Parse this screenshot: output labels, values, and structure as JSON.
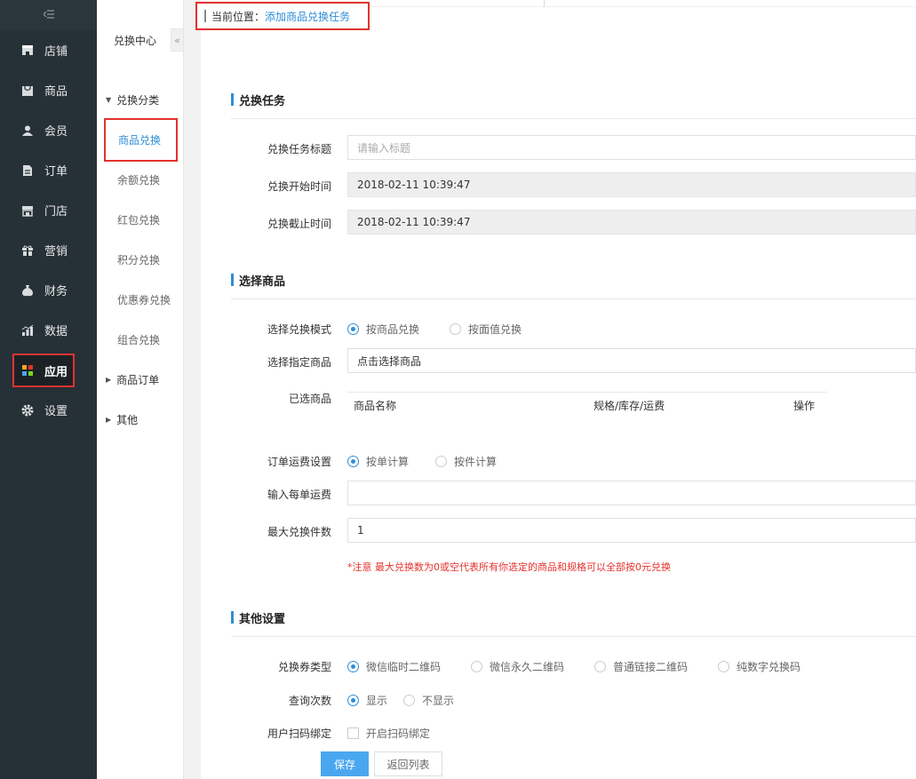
{
  "sidebar": {
    "collapse_icon": "collapse-icon",
    "items": [
      {
        "label": "店铺",
        "icon": "store-icon"
      },
      {
        "label": "商品",
        "icon": "goods-icon"
      },
      {
        "label": "会员",
        "icon": "member-icon"
      },
      {
        "label": "订单",
        "icon": "order-icon"
      },
      {
        "label": "门店",
        "icon": "shop-icon"
      },
      {
        "label": "营销",
        "icon": "gift-icon"
      },
      {
        "label": "财务",
        "icon": "moneybag-icon"
      },
      {
        "label": "数据",
        "icon": "chart-icon"
      },
      {
        "label": "应用",
        "icon": "apps-icon"
      },
      {
        "label": "设置",
        "icon": "gear-icon"
      }
    ],
    "active_index": 8
  },
  "subnav": {
    "title": "兑换中心",
    "collapse_glyph": "«",
    "group1": "兑换分类",
    "items": [
      "商品兑换",
      "余额兑换",
      "红包兑换",
      "积分兑换",
      "优惠券兑换",
      "组合兑换"
    ],
    "group2": "商品订单",
    "group3": "其他"
  },
  "breadcrumb": {
    "prefix": "当前位置：",
    "current": "添加商品兑换任务"
  },
  "section1": {
    "title": "兑换任务",
    "title_label": "兑换任务标题",
    "title_placeholder": "请输入标题",
    "start_label": "兑换开始时间",
    "start_value": "2018-02-11 10:39:47",
    "end_label": "兑换截止时间",
    "end_value": "2018-02-11 10:39:47"
  },
  "section2": {
    "title": "选择商品",
    "mode_label": "选择兑换模式",
    "mode_options": [
      "按商品兑换",
      "按面值兑换"
    ],
    "goods_label": "选择指定商品",
    "goods_value": "点击选择商品",
    "selected_label": "已选商品",
    "table_cols": [
      "商品名称",
      "规格/库存/运费",
      "操作"
    ],
    "freight_label": "订单运费设置",
    "freight_options": [
      "按单计算",
      "按件计算"
    ],
    "unit_freight_label": "输入每单运费",
    "max_label": "最大兑换件数",
    "max_value": "1",
    "note": "*注意 最大兑换数为0或空代表所有你选定的商品和规格可以全部按0元兑换"
  },
  "section3": {
    "title": "其他设置",
    "type_label": "兑换券类型",
    "type_options": [
      "微信临时二维码",
      "微信永久二维码",
      "普通链接二维码",
      "纯数字兑换码"
    ],
    "query_label": "查询次数",
    "query_options": [
      "显示",
      "不显示"
    ],
    "bind_label": "用户扫码绑定",
    "bind_option": "开启扫码绑定"
  },
  "actions": {
    "save": "保存",
    "back": "返回列表"
  },
  "colors": {
    "sidebar_bg": "#263037",
    "accent": "#2e8ed7",
    "primary_button": "#4aa7ef",
    "warning": "#e3322e"
  }
}
